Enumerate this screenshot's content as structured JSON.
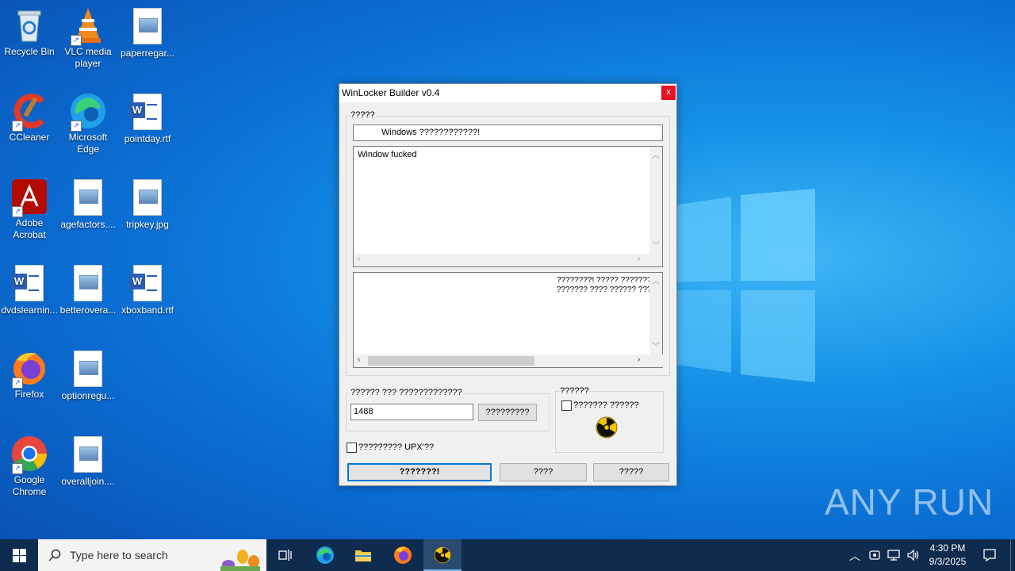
{
  "desktop": {
    "icons": [
      {
        "label": "Recycle Bin"
      },
      {
        "label": "VLC media player"
      },
      {
        "label": "paperregar..."
      },
      {
        "label": "CCleaner"
      },
      {
        "label": "Microsoft Edge"
      },
      {
        "label": "pointday.rtf"
      },
      {
        "label": "Adobe Acrobat"
      },
      {
        "label": "agefactors...."
      },
      {
        "label": "tripkey.jpg"
      },
      {
        "label": "dvdslearnin..."
      },
      {
        "label": "betterovera..."
      },
      {
        "label": "xboxband.rtf"
      },
      {
        "label": "Firefox"
      },
      {
        "label": "optionregu..."
      },
      {
        "label": "Google Chrome"
      },
      {
        "label": "overalljoin...."
      }
    ],
    "watermark": "ANY RUN"
  },
  "dialog": {
    "title": "WinLocker Builder v0.4",
    "close_label": "x",
    "group1_label": "?????",
    "header_text": "Windows ????????????!",
    "message_text": "Window fucked",
    "right_text_line1": "????????! ????? ???????",
    "right_text_line2": "??????? ???? ?????? ???",
    "group2_label": "?????? ??? ?????????????",
    "code_value": "1488",
    "generate_label": "?????????",
    "group3_label": "??????",
    "checkbox1_label": "??????? ??????",
    "upx_label": "????????? UPX'??",
    "btn_create": "???????!",
    "btn_2": "????",
    "btn_3": "?????"
  },
  "taskbar": {
    "search_placeholder": "Type here to search",
    "time": "4:30 PM",
    "date": "9/3/2025"
  },
  "colors": {
    "accent_close": "#e81123",
    "taskbar": "#0f2b4d"
  }
}
